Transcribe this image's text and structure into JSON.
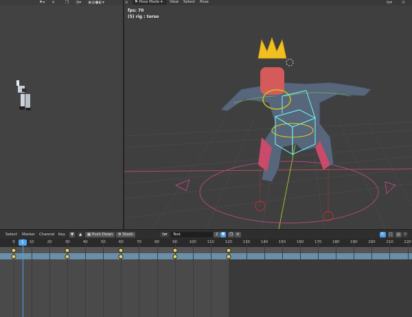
{
  "viewport_left": {
    "icons": [
      "pose-icon",
      "xray-icon",
      "overlay-icon",
      "shading-icons"
    ]
  },
  "viewport_right": {
    "mode": "Pose Mode",
    "menus": [
      "View",
      "Select",
      "Pose"
    ],
    "fps_text": "fps: 70",
    "object_text": "(5) rig : torso"
  },
  "timeline": {
    "menus": [
      "Select",
      "Marker",
      "Channel",
      "Key"
    ],
    "push_down": "Push Down",
    "stash": "Stash",
    "action_name": "Test",
    "users": "2",
    "current_frame": "5",
    "ticks": [
      "0",
      "10",
      "20",
      "30",
      "40",
      "50",
      "60",
      "70",
      "80",
      "90",
      "100",
      "110",
      "120",
      "130",
      "140",
      "150",
      "160",
      "170",
      "180",
      "190",
      "200",
      "210",
      "220"
    ],
    "keyframes": [
      0,
      30,
      60,
      90,
      120
    ],
    "range_end": 120
  },
  "colors": {
    "accent": "#4fa3ef",
    "keyframe": "#f0d060",
    "action_row": "#6a8fa8"
  }
}
